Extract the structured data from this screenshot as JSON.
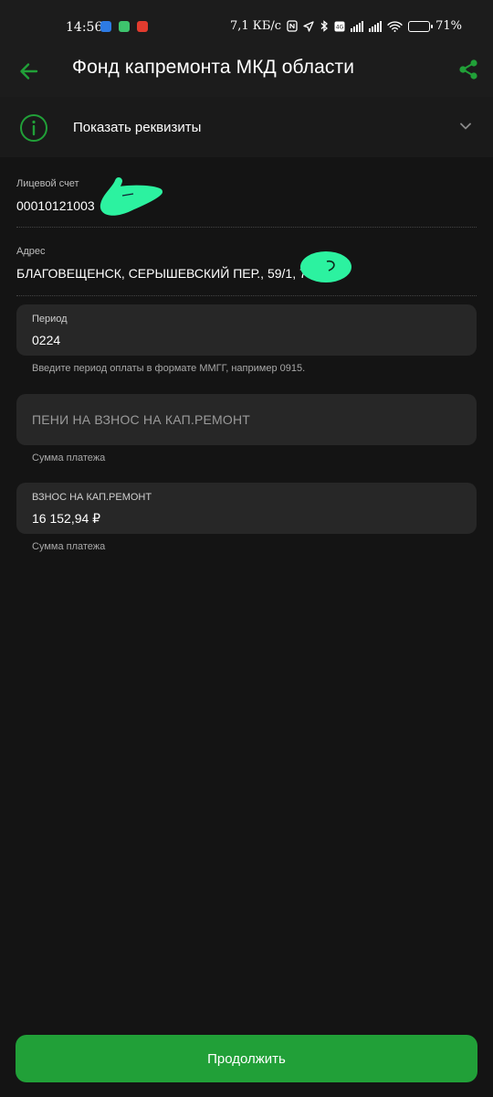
{
  "status_bar": {
    "time": "14:56",
    "network_speed": "7,1 КБ/с",
    "battery_level": 0.71,
    "battery": "71%",
    "icons": [
      "chat-app-icon",
      "message-app-icon",
      "red-app-icon",
      "nfc-icon",
      "location-icon",
      "bluetooth-icon",
      "volte-icon",
      "signal-icon",
      "signal-icon",
      "wifi-icon",
      "battery-icon"
    ]
  },
  "header": {
    "title": "Фонд капремонта МКД области",
    "back_icon": "arrow-left-icon",
    "share_icon": "share-icon"
  },
  "details": {
    "label": "Показать реквизиты",
    "icon": "info-icon"
  },
  "account": {
    "label": "Лицевой счет",
    "value": "00010121003"
  },
  "address": {
    "label": "Адрес",
    "value": "БЛАГОВЕЩЕНСК, СЕРЫШЕВСКИЙ ПЕР., 59/1, 7"
  },
  "period": {
    "label": "Период",
    "value": "0224",
    "hint": "Введите период оплаты в формате ММГГ, например 0915."
  },
  "penalty": {
    "placeholder": "ПЕНИ НА ВЗНОС НА КАП.РЕМОНТ",
    "hint": "Сумма платежа"
  },
  "contribution": {
    "label": "ВЗНОС НА КАП.РЕМОНТ",
    "value": "16 152,94 ₽",
    "hint": "Сумма платежа"
  },
  "continue_label": "Продолжить",
  "colors": {
    "accent": "#21a038",
    "background": "#141414",
    "card": "#272727",
    "scribble": "#2cf2a0"
  }
}
